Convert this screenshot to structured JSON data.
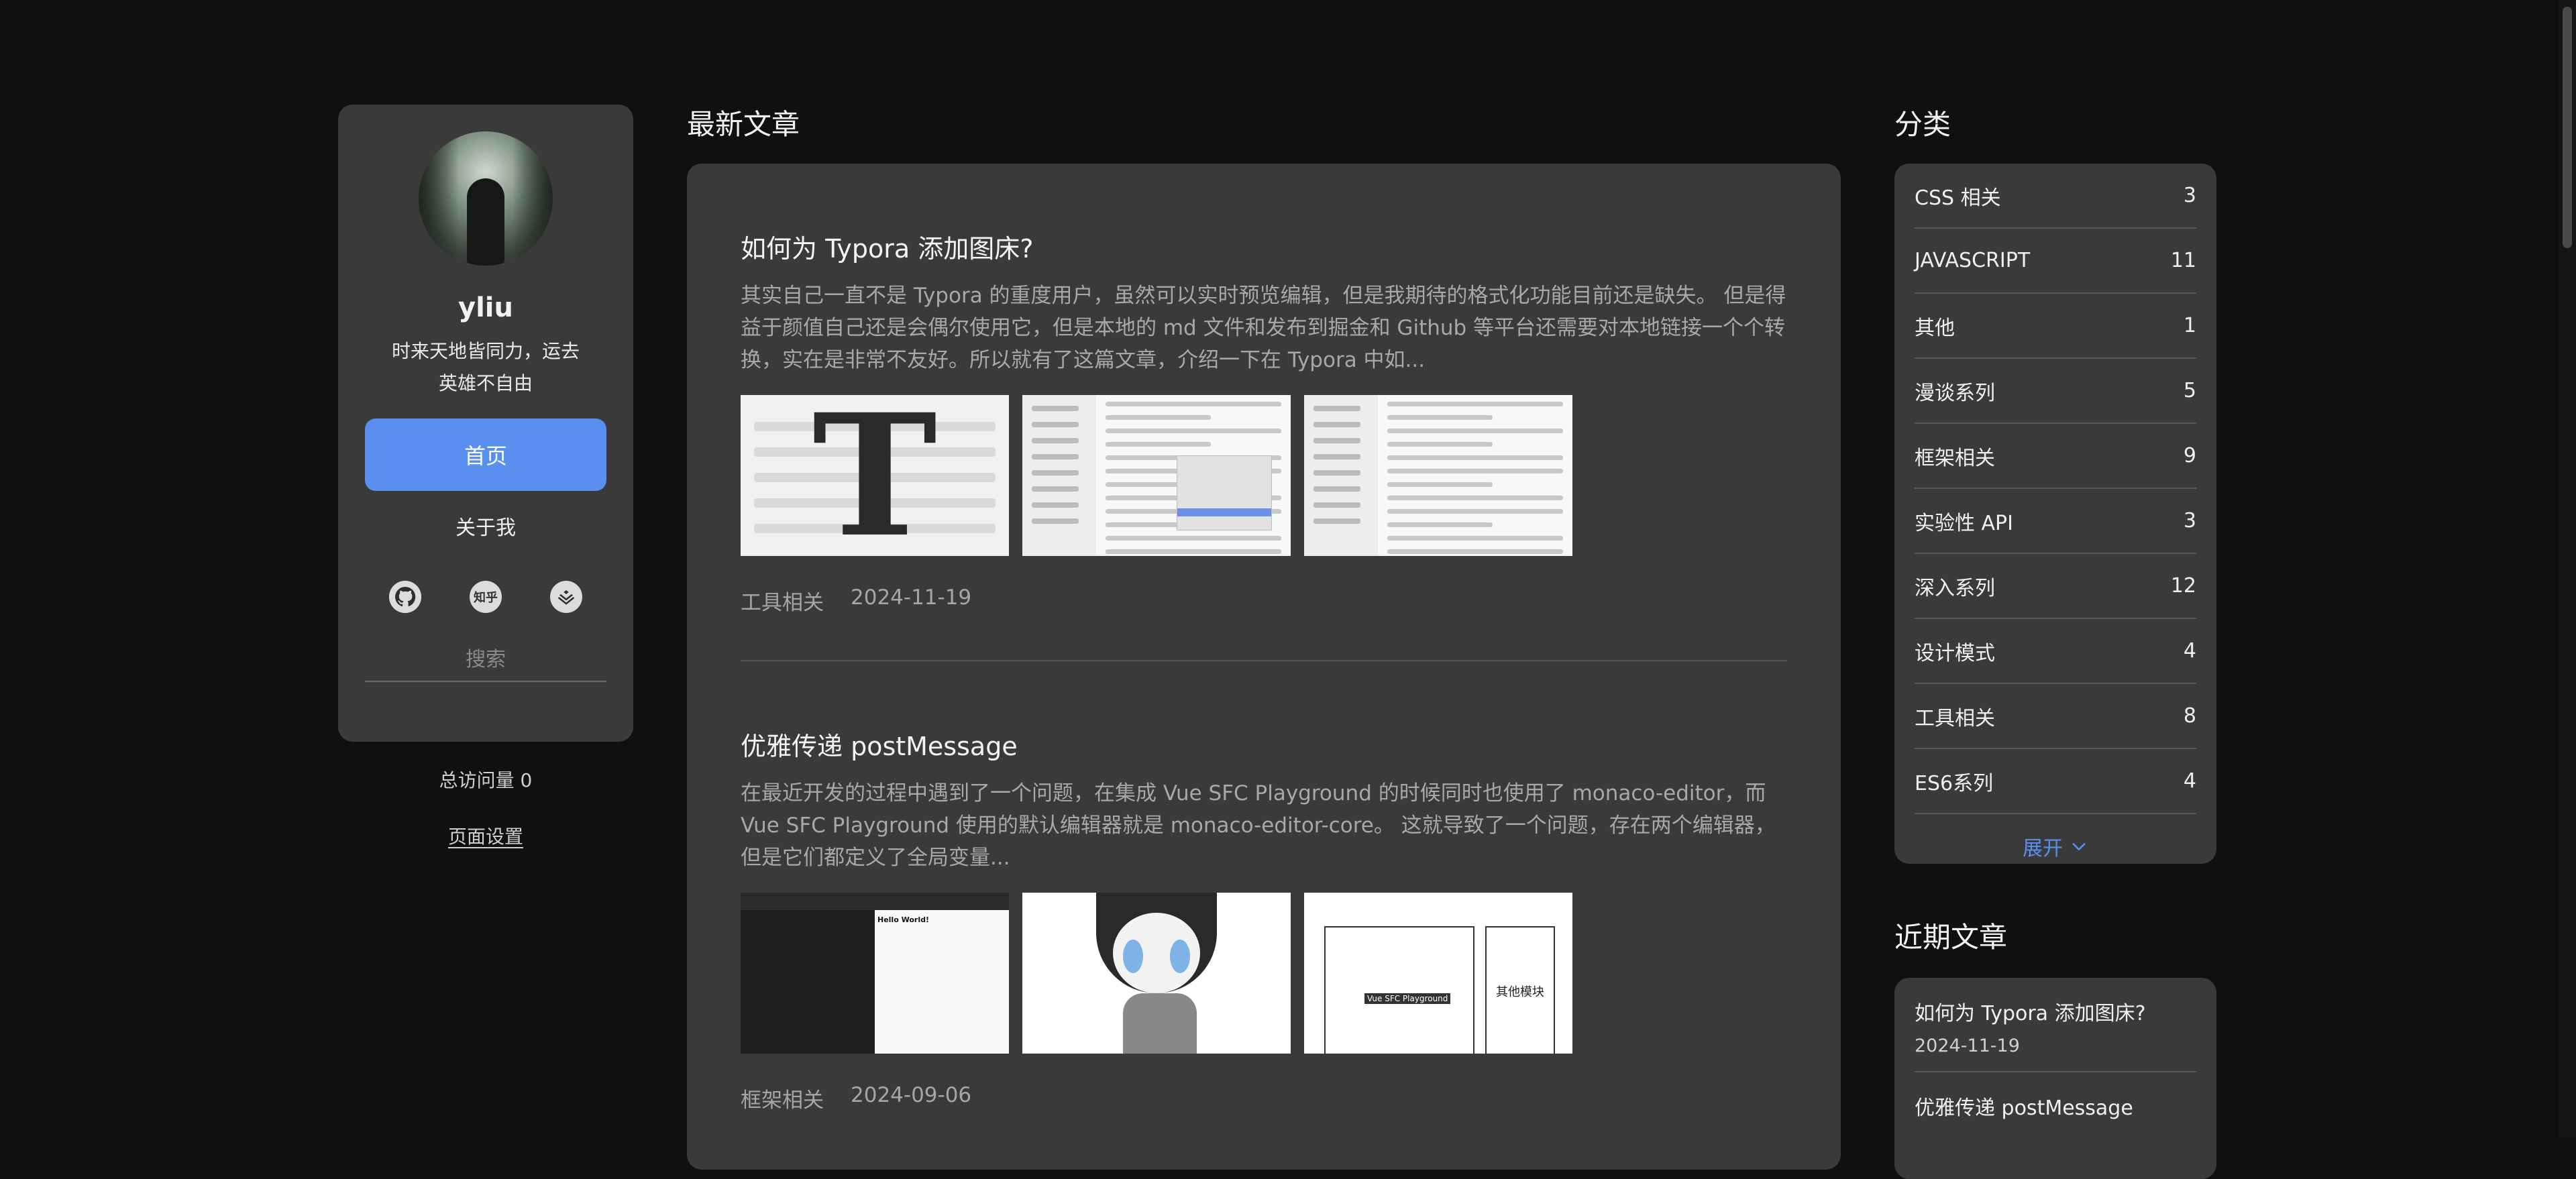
{
  "profile": {
    "username": "yliu",
    "motto": "时来天地皆同力，运去英雄不自由",
    "home_label": "首页",
    "about_label": "关于我",
    "zhihu_label": "知乎",
    "search_placeholder": "搜索",
    "visits_label": "总访问量 0",
    "page_settings_label": "页面设置"
  },
  "main": {
    "section_title": "最新文章",
    "articles": [
      {
        "title": "如何为 Typora 添加图床?",
        "excerpt": "其实自己一直不是 Typora 的重度用户，虽然可以实时预览编辑，但是我期待的格式化功能目前还是缺失。 但是得益于颜值自己还是会偶尔使用它，但是本地的 md 文件和发布到掘金和 Github 等平台还需要对本地链接一个个转换，实在是非常不友好。所以就有了这篇文章，介绍一下在 Typora 中如...",
        "category": "工具相关",
        "date": "2024-11-19"
      },
      {
        "title": "优雅传递 postMessage",
        "excerpt": "在最近开发的过程中遇到了一个问题，在集成 Vue SFC Playground 的时候同时也使用了 monaco-editor，而 Vue SFC Playground 使用的默认编辑器就是 monaco-editor-core。 这就导致了一个问题，存在两个编辑器，但是它们都定义了全局变量...",
        "category": "框架相关",
        "date": "2024-09-06",
        "thumb1_text": "Hello World!",
        "thumb3_box1": "Vue SFC Playground",
        "thumb3_box2": "其他模块"
      }
    ]
  },
  "sidebar": {
    "categories_title": "分类",
    "categories": [
      {
        "name": "CSS 相关",
        "count": "3"
      },
      {
        "name": "JAVASCRIPT",
        "count": "11"
      },
      {
        "name": "其他",
        "count": "1"
      },
      {
        "name": "漫谈系列",
        "count": "5"
      },
      {
        "name": "框架相关",
        "count": "9"
      },
      {
        "name": "实验性 API",
        "count": "3"
      },
      {
        "name": "深入系列",
        "count": "12"
      },
      {
        "name": "设计模式",
        "count": "4"
      },
      {
        "name": "工具相关",
        "count": "8"
      },
      {
        "name": "ES6系列",
        "count": "4"
      }
    ],
    "expand_label": "展开",
    "recent_title": "近期文章",
    "recent": [
      {
        "title": "如何为 Typora 添加图床?",
        "date": "2024-11-19"
      },
      {
        "title": "优雅传递 postMessage",
        "date": ""
      }
    ]
  },
  "colors": {
    "accent": "#5a8ff0",
    "card": "#3a3a3a",
    "background": "#101010"
  }
}
